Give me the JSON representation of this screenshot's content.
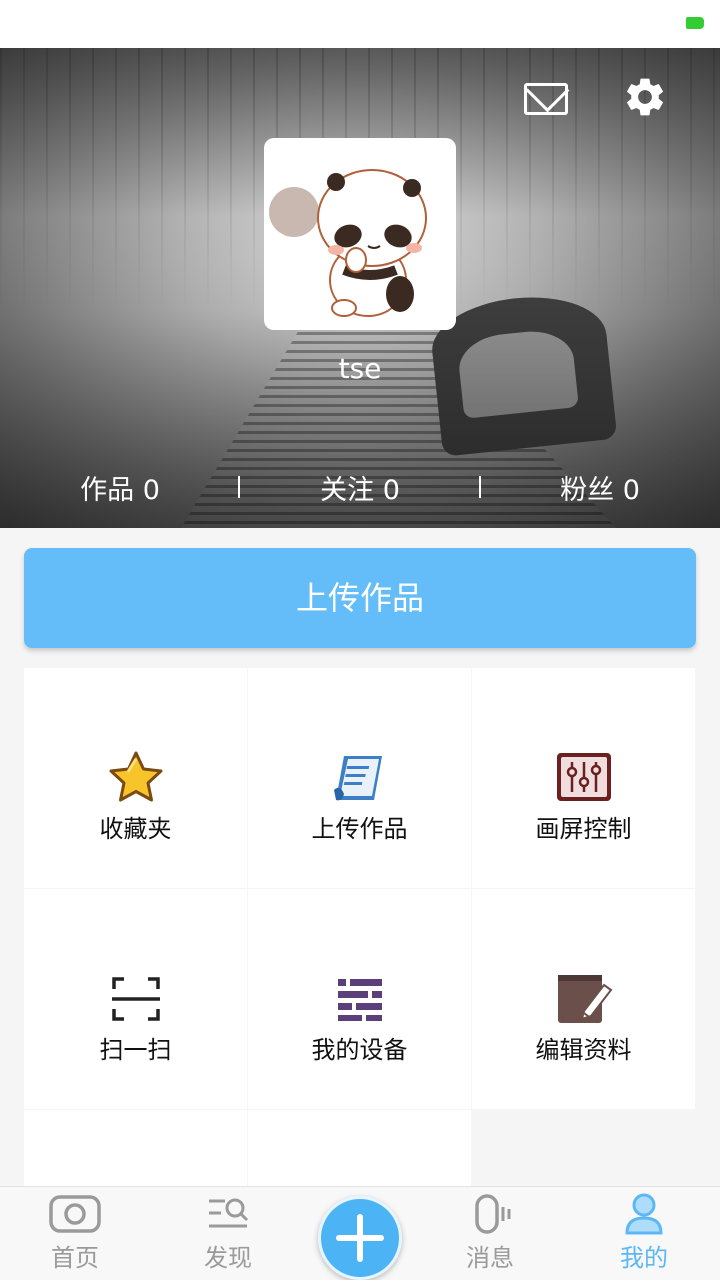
{
  "profile": {
    "username": "tse",
    "stats": [
      {
        "label": "作品",
        "value": "0"
      },
      {
        "label": "关注",
        "value": "0"
      },
      {
        "label": "粉丝",
        "value": "0"
      }
    ]
  },
  "upload_button": {
    "label": "上传作品"
  },
  "menu": [
    {
      "label": "收藏夹",
      "icon": "star-icon"
    },
    {
      "label": "上传作品",
      "icon": "document-icon"
    },
    {
      "label": "画屏控制",
      "icon": "sliders-icon"
    },
    {
      "label": "扫一扫",
      "icon": "scan-icon"
    },
    {
      "label": "我的设备",
      "icon": "list-icon"
    },
    {
      "label": "编辑资料",
      "icon": "edit-icon"
    }
  ],
  "tabbar": {
    "items": [
      {
        "label": "首页",
        "icon": "camera-icon"
      },
      {
        "label": "发现",
        "icon": "discover-icon"
      },
      {
        "label": "消息",
        "icon": "message-icon"
      },
      {
        "label": "我的",
        "icon": "user-icon"
      }
    ],
    "active": "我的",
    "center_button": "add-icon"
  },
  "colors": {
    "accent": "#64bdf8",
    "active_tab": "#5cb8f5",
    "battery": "#33cc33"
  }
}
